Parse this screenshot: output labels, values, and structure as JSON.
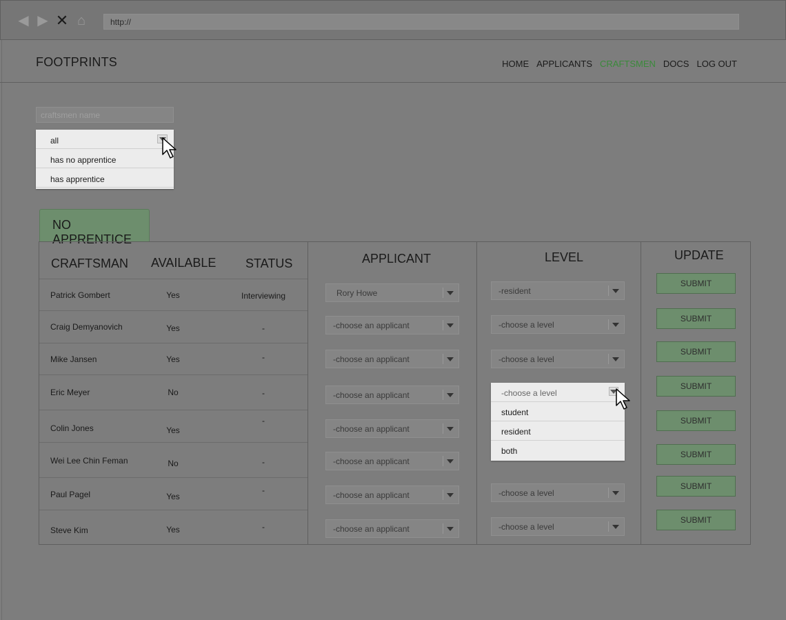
{
  "browser": {
    "back_icon": "arrow-left-icon",
    "forward_icon": "arrow-right-icon",
    "stop_icon": "close-icon",
    "home_icon": "home-icon",
    "url": "http://"
  },
  "app": {
    "brand": "FOOTPRINTS",
    "nav": [
      {
        "label": "HOME",
        "active": false
      },
      {
        "label": "APPLICANTS",
        "active": false
      },
      {
        "label": "CRAFTSMEN",
        "active": true
      },
      {
        "label": "DOCS",
        "active": false
      },
      {
        "label": "LOG OUT",
        "active": false
      }
    ],
    "active_color": "#3a8a3a"
  },
  "filters": {
    "search_placeholder": "craftsmen name",
    "filter_selected": "all",
    "filter_options": [
      "all",
      "has no apprentice",
      "has apprentice"
    ]
  },
  "tab": {
    "label": "NO APPRENTICE",
    "color": "#6d8e6d"
  },
  "table": {
    "headers": {
      "craftsman": "CRAFTSMAN",
      "available": "AVAILABLE",
      "status": "STATUS",
      "applicant": "APPLICANT",
      "level": "LEVEL",
      "update": "UPDATE"
    },
    "rows": [
      {
        "craftsman": "Patrick Gombert",
        "available": "Yes",
        "status": "Interviewing",
        "applicant": "Rory Howe",
        "level": "-resident"
      },
      {
        "craftsman": "Craig Demyanovich",
        "available": "Yes",
        "status": "-",
        "applicant": "-choose an applicant",
        "level": "-choose a level"
      },
      {
        "craftsman": "Mike Jansen",
        "available": "Yes",
        "status": "-",
        "applicant": "-choose an applicant",
        "level": "-choose a level"
      },
      {
        "craftsman": "Eric Meyer",
        "available": "No",
        "status": "-",
        "applicant": "-choose an applicant",
        "level": "-choose a level"
      },
      {
        "craftsman": "Colin Jones",
        "available": "Yes",
        "status": "-",
        "applicant": "-choose an applicant",
        "level": "-choose a level"
      },
      {
        "craftsman": "Wei Lee Chin Feman",
        "available": "No",
        "status": "-",
        "applicant": "-choose an applicant",
        "level": "-choose a level"
      },
      {
        "craftsman": "Paul Pagel",
        "available": "Yes",
        "status": "-",
        "applicant": "-choose an applicant",
        "level": "-choose a level"
      },
      {
        "craftsman": "Steve Kim",
        "available": "Yes",
        "status": "-",
        "applicant": "-choose an applicant",
        "level": "-choose a level"
      }
    ],
    "submit_label": "SUBMIT"
  },
  "level_dropdown": {
    "current": "-choose a level",
    "options": [
      "student",
      "resident",
      "both"
    ]
  },
  "submit_color": "#6d8e6d"
}
